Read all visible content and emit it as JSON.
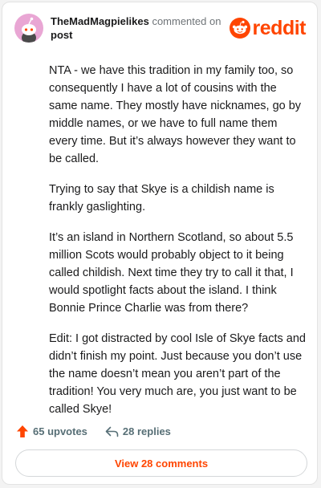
{
  "colors": {
    "brand": "#ff4500",
    "text": "#1a1a1b",
    "muted": "#6f7478",
    "avatar_bg": "#e9a6d4"
  },
  "header": {
    "username": "TheMadMagpielikes",
    "action_text": "commented on",
    "target": "post",
    "logo_text": "reddit",
    "logo_icon": "reddit-snoo-icon",
    "avatar_icon": "snoo-avatar-icon"
  },
  "comment": {
    "paragraphs": [
      "NTA - we have this tradition in my family too, so consequently I have a lot of cousins with the same name. They mostly have nicknames, go by middle names, or we have to full name them every time. But it’s always however they want to be called.",
      "Trying to say that Skye is a childish name is frankly gaslighting.",
      "It’s an island in Northern Scotland, so about 5.5 million Scots would probably object to it being called childish. Next time they try to call it that, I would spotlight facts about the island. I think Bonnie Prince Charlie was from there?",
      "Edit: I got distracted by cool Isle of Skye facts and didn’t finish my point. Just because you don’t use the name doesn’t mean you aren’t part of the tradition! You very much are, you just want to be called Skye!"
    ]
  },
  "footer": {
    "upvotes": "65 upvotes",
    "upvote_icon": "upvote-arrow-icon",
    "replies": "28 replies",
    "reply_icon": "reply-arrow-icon",
    "view_comments": "View 28 comments"
  }
}
